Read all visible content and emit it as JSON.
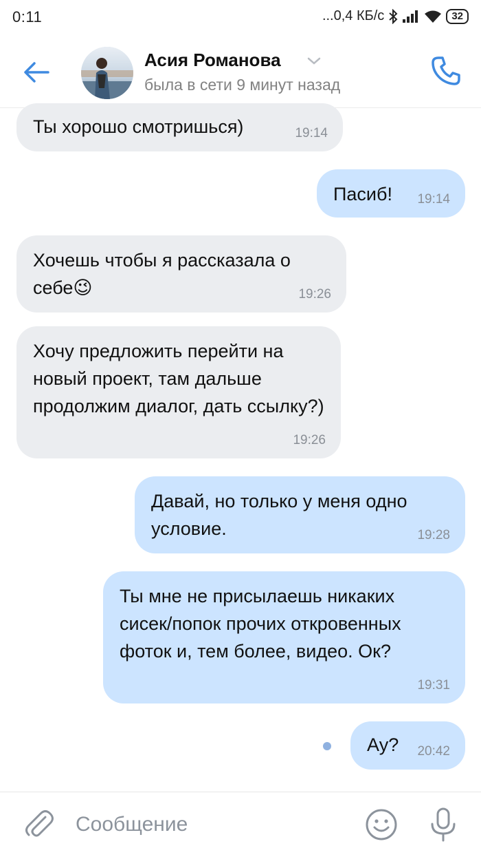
{
  "status_bar": {
    "time": "0:11",
    "network": "...0,4 КБ/с",
    "battery": "32"
  },
  "header": {
    "contact_name": "Асия Романова",
    "contact_status": "была в сети 9 минут назад",
    "icons": {
      "back": "back-arrow-icon",
      "call": "phone-icon",
      "chevron": "chevron-down-icon"
    }
  },
  "colors": {
    "accent": "#3f8ae0",
    "incoming_bubble": "#ebedf0",
    "outgoing_bubble": "#cce4ff",
    "unread_dot": "#8fb1e0"
  },
  "messages": [
    {
      "direction": "in",
      "text": "Ты хорошо смотришься)",
      "time": "19:14"
    },
    {
      "direction": "out",
      "text": "Пасиб!",
      "time": "19:14"
    },
    {
      "direction": "in",
      "text": "Хочешь чтобы я рассказала о себе😉",
      "time": "19:26"
    },
    {
      "direction": "in",
      "text": "Хочу предложить перейти на новый проект, там дальше продолжим диалог, дать ссылку?)",
      "time": "19:26"
    },
    {
      "direction": "out",
      "text": "Давай, но только у меня одно условие.",
      "time": "19:28"
    },
    {
      "direction": "out",
      "text": "Ты мне не присылаешь никаких сисек/попок прочих откровенных фоток и, тем более, видео. Ок?",
      "time": "19:31"
    },
    {
      "direction": "out",
      "text": "Ау?",
      "time": "20:42",
      "unread": true
    }
  ],
  "compose": {
    "placeholder": "Сообщение",
    "icons": {
      "attach": "paperclip-icon",
      "emoji": "smiley-icon",
      "mic": "microphone-icon"
    }
  }
}
